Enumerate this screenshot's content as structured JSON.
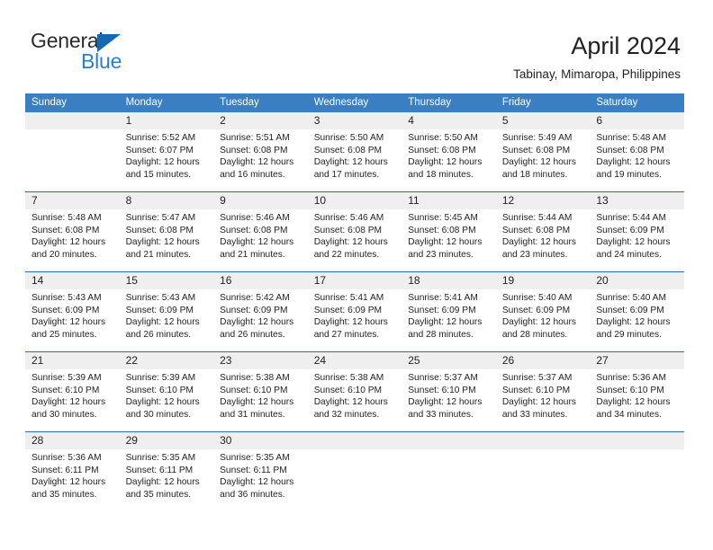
{
  "brand": {
    "name_top": "General",
    "name_bottom": "Blue",
    "accent_color": "#1668b3"
  },
  "header": {
    "title": "April 2024",
    "subtitle": "Tabinay, Mimaropa, Philippines"
  },
  "theme": {
    "header_blue": "#3a7fc1",
    "separator_blue": "#2b6ca8",
    "daynum_band": "#efefef",
    "text": "#231f20"
  },
  "weekday_headers": [
    "Sunday",
    "Monday",
    "Tuesday",
    "Wednesday",
    "Thursday",
    "Friday",
    "Saturday"
  ],
  "weeks": [
    [
      {
        "day": "",
        "lines": []
      },
      {
        "day": "1",
        "lines": [
          "Sunrise: 5:52 AM",
          "Sunset: 6:07 PM",
          "Daylight: 12 hours",
          "and 15 minutes."
        ]
      },
      {
        "day": "2",
        "lines": [
          "Sunrise: 5:51 AM",
          "Sunset: 6:08 PM",
          "Daylight: 12 hours",
          "and 16 minutes."
        ]
      },
      {
        "day": "3",
        "lines": [
          "Sunrise: 5:50 AM",
          "Sunset: 6:08 PM",
          "Daylight: 12 hours",
          "and 17 minutes."
        ]
      },
      {
        "day": "4",
        "lines": [
          "Sunrise: 5:50 AM",
          "Sunset: 6:08 PM",
          "Daylight: 12 hours",
          "and 18 minutes."
        ]
      },
      {
        "day": "5",
        "lines": [
          "Sunrise: 5:49 AM",
          "Sunset: 6:08 PM",
          "Daylight: 12 hours",
          "and 18 minutes."
        ]
      },
      {
        "day": "6",
        "lines": [
          "Sunrise: 5:48 AM",
          "Sunset: 6:08 PM",
          "Daylight: 12 hours",
          "and 19 minutes."
        ]
      }
    ],
    [
      {
        "day": "7",
        "lines": [
          "Sunrise: 5:48 AM",
          "Sunset: 6:08 PM",
          "Daylight: 12 hours",
          "and 20 minutes."
        ]
      },
      {
        "day": "8",
        "lines": [
          "Sunrise: 5:47 AM",
          "Sunset: 6:08 PM",
          "Daylight: 12 hours",
          "and 21 minutes."
        ]
      },
      {
        "day": "9",
        "lines": [
          "Sunrise: 5:46 AM",
          "Sunset: 6:08 PM",
          "Daylight: 12 hours",
          "and 21 minutes."
        ]
      },
      {
        "day": "10",
        "lines": [
          "Sunrise: 5:46 AM",
          "Sunset: 6:08 PM",
          "Daylight: 12 hours",
          "and 22 minutes."
        ]
      },
      {
        "day": "11",
        "lines": [
          "Sunrise: 5:45 AM",
          "Sunset: 6:08 PM",
          "Daylight: 12 hours",
          "and 23 minutes."
        ]
      },
      {
        "day": "12",
        "lines": [
          "Sunrise: 5:44 AM",
          "Sunset: 6:08 PM",
          "Daylight: 12 hours",
          "and 23 minutes."
        ]
      },
      {
        "day": "13",
        "lines": [
          "Sunrise: 5:44 AM",
          "Sunset: 6:09 PM",
          "Daylight: 12 hours",
          "and 24 minutes."
        ]
      }
    ],
    [
      {
        "day": "14",
        "lines": [
          "Sunrise: 5:43 AM",
          "Sunset: 6:09 PM",
          "Daylight: 12 hours",
          "and 25 minutes."
        ]
      },
      {
        "day": "15",
        "lines": [
          "Sunrise: 5:43 AM",
          "Sunset: 6:09 PM",
          "Daylight: 12 hours",
          "and 26 minutes."
        ]
      },
      {
        "day": "16",
        "lines": [
          "Sunrise: 5:42 AM",
          "Sunset: 6:09 PM",
          "Daylight: 12 hours",
          "and 26 minutes."
        ]
      },
      {
        "day": "17",
        "lines": [
          "Sunrise: 5:41 AM",
          "Sunset: 6:09 PM",
          "Daylight: 12 hours",
          "and 27 minutes."
        ]
      },
      {
        "day": "18",
        "lines": [
          "Sunrise: 5:41 AM",
          "Sunset: 6:09 PM",
          "Daylight: 12 hours",
          "and 28 minutes."
        ]
      },
      {
        "day": "19",
        "lines": [
          "Sunrise: 5:40 AM",
          "Sunset: 6:09 PM",
          "Daylight: 12 hours",
          "and 28 minutes."
        ]
      },
      {
        "day": "20",
        "lines": [
          "Sunrise: 5:40 AM",
          "Sunset: 6:09 PM",
          "Daylight: 12 hours",
          "and 29 minutes."
        ]
      }
    ],
    [
      {
        "day": "21",
        "lines": [
          "Sunrise: 5:39 AM",
          "Sunset: 6:10 PM",
          "Daylight: 12 hours",
          "and 30 minutes."
        ]
      },
      {
        "day": "22",
        "lines": [
          "Sunrise: 5:39 AM",
          "Sunset: 6:10 PM",
          "Daylight: 12 hours",
          "and 30 minutes."
        ]
      },
      {
        "day": "23",
        "lines": [
          "Sunrise: 5:38 AM",
          "Sunset: 6:10 PM",
          "Daylight: 12 hours",
          "and 31 minutes."
        ]
      },
      {
        "day": "24",
        "lines": [
          "Sunrise: 5:38 AM",
          "Sunset: 6:10 PM",
          "Daylight: 12 hours",
          "and 32 minutes."
        ]
      },
      {
        "day": "25",
        "lines": [
          "Sunrise: 5:37 AM",
          "Sunset: 6:10 PM",
          "Daylight: 12 hours",
          "and 33 minutes."
        ]
      },
      {
        "day": "26",
        "lines": [
          "Sunrise: 5:37 AM",
          "Sunset: 6:10 PM",
          "Daylight: 12 hours",
          "and 33 minutes."
        ]
      },
      {
        "day": "27",
        "lines": [
          "Sunrise: 5:36 AM",
          "Sunset: 6:10 PM",
          "Daylight: 12 hours",
          "and 34 minutes."
        ]
      }
    ],
    [
      {
        "day": "28",
        "lines": [
          "Sunrise: 5:36 AM",
          "Sunset: 6:11 PM",
          "Daylight: 12 hours",
          "and 35 minutes."
        ]
      },
      {
        "day": "29",
        "lines": [
          "Sunrise: 5:35 AM",
          "Sunset: 6:11 PM",
          "Daylight: 12 hours",
          "and 35 minutes."
        ]
      },
      {
        "day": "30",
        "lines": [
          "Sunrise: 5:35 AM",
          "Sunset: 6:11 PM",
          "Daylight: 12 hours",
          "and 36 minutes."
        ]
      },
      {
        "day": "",
        "lines": []
      },
      {
        "day": "",
        "lines": []
      },
      {
        "day": "",
        "lines": []
      },
      {
        "day": "",
        "lines": []
      }
    ]
  ]
}
